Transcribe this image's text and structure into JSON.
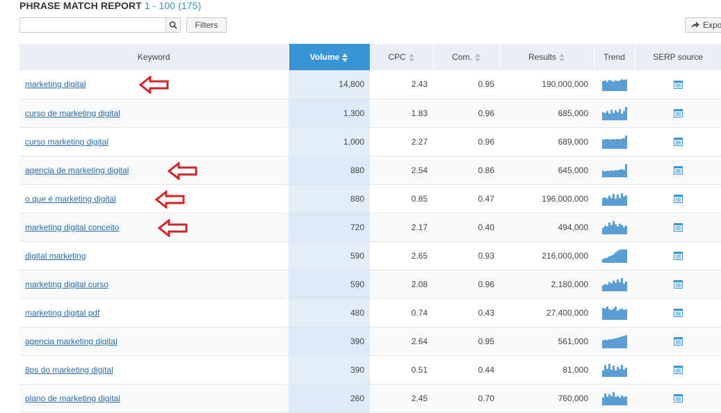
{
  "report": {
    "title": "PHRASE MATCH REPORT",
    "range": "1 - 100 (175)"
  },
  "search": {
    "value": "",
    "placeholder": ""
  },
  "buttons": {
    "filters": "Filters",
    "export": "Expo"
  },
  "columns": {
    "keyword": "Keyword",
    "volume": "Volume",
    "cpc": "CPC",
    "com": "Com.",
    "results": "Results",
    "trend": "Trend",
    "serp": "SERP source"
  },
  "rows": [
    {
      "keyword": "marketing digital",
      "volume": "14,800",
      "cpc": "2.43",
      "com": "0.95",
      "results": "190,000,000",
      "trend": [
        0.75,
        0.8,
        0.7,
        0.85,
        0.78,
        0.72,
        0.82,
        0.76,
        0.8,
        0.9,
        0.85,
        0.88
      ],
      "arrow": true
    },
    {
      "keyword": "curso de marketing digital",
      "volume": "1,300",
      "cpc": "1.83",
      "com": "0.96",
      "results": "685,000",
      "trend": [
        0.6,
        0.55,
        0.7,
        0.5,
        0.8,
        0.55,
        0.75,
        0.6,
        0.85,
        0.5,
        0.7,
        1.0
      ],
      "arrow": false
    },
    {
      "keyword": "curso marketing digital",
      "volume": "1,000",
      "cpc": "2.27",
      "com": "0.96",
      "results": "689,000",
      "trend": [
        0.7,
        0.72,
        0.74,
        0.7,
        0.72,
        0.73,
        0.71,
        0.74,
        0.72,
        0.76,
        0.8,
        1.0
      ],
      "arrow": false
    },
    {
      "keyword": "agencia de marketing digital",
      "volume": "880",
      "cpc": "2.54",
      "com": "0.86",
      "results": "645,000",
      "trend": [
        0.5,
        0.45,
        0.5,
        0.48,
        0.52,
        0.5,
        0.55,
        0.52,
        0.58,
        0.62,
        0.55,
        1.0
      ],
      "arrow": true
    },
    {
      "keyword": "o que é marketing digital",
      "volume": "880",
      "cpc": "0.85",
      "com": "0.47",
      "results": "196,000,000",
      "trend": [
        0.6,
        0.65,
        0.55,
        0.75,
        0.6,
        0.9,
        0.55,
        0.85,
        0.6,
        0.95,
        0.7,
        0.8
      ],
      "arrow": true
    },
    {
      "keyword": "marketing digital conceito",
      "volume": "720",
      "cpc": "2.17",
      "com": "0.40",
      "results": "494,000",
      "trend": [
        0.5,
        0.65,
        0.6,
        0.9,
        0.7,
        1.0,
        0.75,
        0.6,
        0.8,
        0.7,
        0.55,
        0.65
      ],
      "arrow": true
    },
    {
      "keyword": "digital marketing",
      "volume": "590",
      "cpc": "2.65",
      "com": "0.93",
      "results": "216,000,000",
      "trend": [
        0.3,
        0.35,
        0.4,
        0.5,
        0.55,
        0.65,
        0.8,
        0.9,
        1.0,
        1.0,
        1.0,
        1.0
      ],
      "arrow": false
    },
    {
      "keyword": "marketing digital curso",
      "volume": "590",
      "cpc": "2.08",
      "com": "0.96",
      "results": "2,180,000",
      "trend": [
        0.45,
        0.55,
        0.5,
        0.7,
        0.6,
        0.8,
        0.65,
        0.9,
        0.7,
        1.0,
        0.6,
        0.75
      ],
      "arrow": false
    },
    {
      "keyword": "marketing digital pdf",
      "volume": "480",
      "cpc": "0.74",
      "com": "0.43",
      "results": "27,400,000",
      "trend": [
        0.9,
        0.85,
        1.0,
        0.8,
        0.75,
        0.85,
        1.0,
        0.7,
        0.8,
        0.85,
        0.75,
        0.8
      ],
      "arrow": false
    },
    {
      "keyword": "agencia marketing digital",
      "volume": "390",
      "cpc": "2.64",
      "com": "0.95",
      "results": "561,000",
      "trend": [
        0.6,
        0.65,
        0.62,
        0.7,
        0.68,
        0.72,
        0.75,
        0.8,
        0.85,
        0.9,
        0.95,
        1.0
      ],
      "arrow": false
    },
    {
      "keyword": "8ps do marketing digital",
      "volume": "390",
      "cpc": "0.51",
      "com": "0.44",
      "results": "81,000",
      "trend": [
        0.5,
        0.9,
        0.6,
        1.0,
        0.55,
        0.85,
        0.5,
        0.75,
        0.6,
        0.9,
        0.55,
        0.7
      ],
      "arrow": false
    },
    {
      "keyword": "plano de marketing digital",
      "volume": "260",
      "cpc": "2.45",
      "com": "0.70",
      "results": "760,000",
      "trend": [
        0.6,
        0.9,
        0.65,
        0.85,
        0.7,
        1.0,
        0.65,
        0.7,
        0.6,
        0.75,
        0.62,
        0.68
      ],
      "arrow": false
    }
  ],
  "colors": {
    "accent": "#3a95d6",
    "trend_bar": "#5a9fd4",
    "arrow": "#d0232a",
    "link": "#2a6da8",
    "serp_icon": "#3a95d6"
  }
}
